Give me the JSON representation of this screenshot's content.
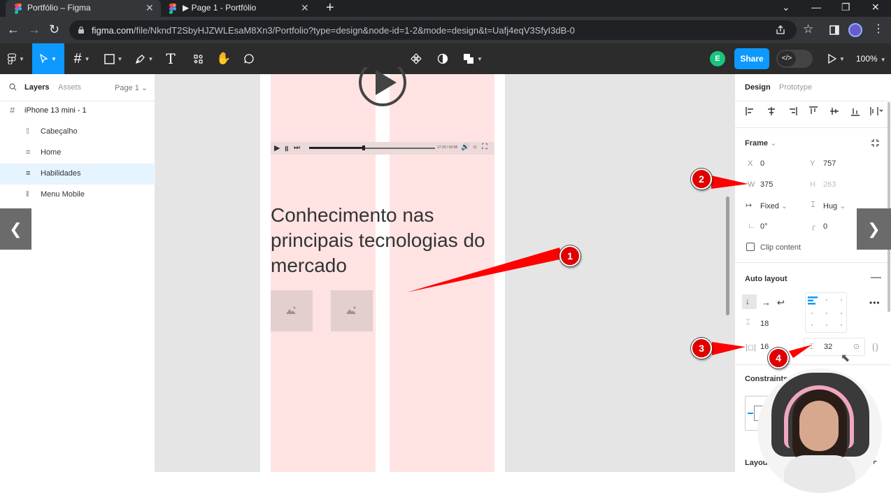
{
  "browser": {
    "tabs": [
      {
        "title": "Portfólio – Figma",
        "close": "✕"
      },
      {
        "title": "▶ Page 1 - Portfólio",
        "close": "✕"
      }
    ],
    "new_tab": "+",
    "url_host": "figma.com",
    "url_path": "/file/NkndT2SbyHJZWLEsaM8Xn3/Portfolio?type=design&node-id=1-2&mode=design&t=Uafj4eqV3SfyI3dB-0"
  },
  "toolbar": {
    "avatar_initial": "E",
    "share_label": "Share",
    "zoom": "100%"
  },
  "layers_panel": {
    "tabs": [
      "Layers",
      "Assets"
    ],
    "page_selector": "Page 1",
    "frame_name": "iPhone 13 mini - 1",
    "layers": [
      {
        "name": "Cabeçalho",
        "selected": false
      },
      {
        "name": "Home",
        "selected": false
      },
      {
        "name": "Habilidades",
        "selected": true
      },
      {
        "name": "Menu Mobile",
        "selected": false
      }
    ]
  },
  "canvas": {
    "heading": "Conhecimento nas principais tecnologias do mercado",
    "player_time": "17:29 / 42:08"
  },
  "design_panel": {
    "tabs": [
      "Design",
      "Prototype"
    ],
    "frame_label": "Frame",
    "x_label": "X",
    "x_value": "0",
    "y_label": "Y",
    "y_value": "757",
    "w_label": "W",
    "w_value": "375",
    "h_label": "H",
    "h_value": "263",
    "width_mode": "Fixed",
    "height_mode": "Hug",
    "rotation": "0°",
    "radius": "0",
    "clip_content": "Clip content",
    "auto_layout_label": "Auto layout",
    "gap": "18",
    "horizontal_padding": "16",
    "vertical_padding": "32",
    "more": "•••",
    "constraints_label": "Constraints",
    "layout_label": "Layout"
  },
  "annotations": [
    "1",
    "2",
    "3",
    "4"
  ],
  "colors": {
    "figma_blue": "#0d99ff",
    "annotation_red": "#e00000",
    "column_guide": "rgba(255,0,0,0.11)"
  }
}
